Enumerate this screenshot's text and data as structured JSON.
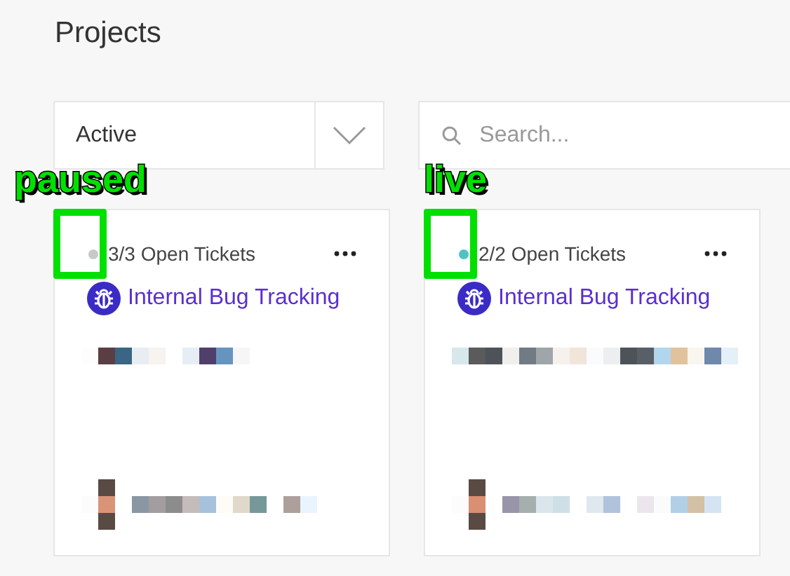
{
  "title": "Projects",
  "filter": {
    "value": "Active"
  },
  "search": {
    "placeholder": "Search..."
  },
  "cards": [
    {
      "tickets": "3/3 Open Tickets",
      "color": "#c8c8c8",
      "name": "Internal Bug Tracking",
      "annotation": "paused"
    },
    {
      "tickets": "2/2 Open Tickets",
      "color": "#4fc3c3",
      "name": "Internal Bug Tracking",
      "annotation": "live"
    }
  ]
}
